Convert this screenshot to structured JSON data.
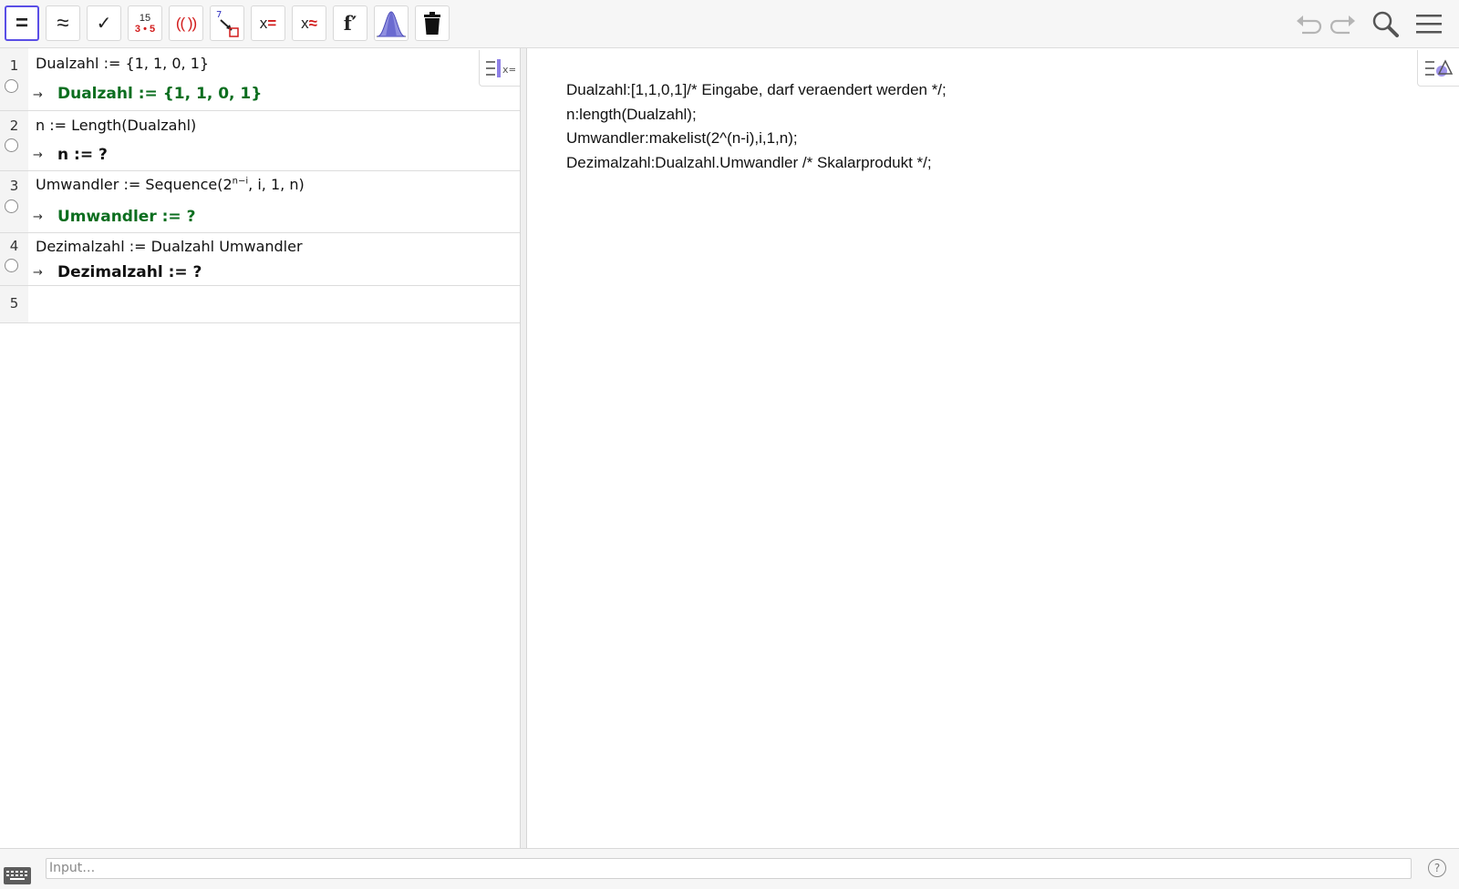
{
  "toolbar": {
    "tools": [
      {
        "name": "evaluate",
        "label": "="
      },
      {
        "name": "numeric",
        "label": "≈"
      },
      {
        "name": "keep-input",
        "label": "✓"
      },
      {
        "name": "factor",
        "label_top": "15",
        "label_bottom": "3 • 5"
      },
      {
        "name": "expand",
        "label": "(( ))"
      },
      {
        "name": "substitute",
        "label": "7"
      },
      {
        "name": "solve",
        "label": "x="
      },
      {
        "name": "solve-numerically",
        "label": "x≈"
      },
      {
        "name": "derivative",
        "label": "f′"
      },
      {
        "name": "probability",
        "label": ""
      },
      {
        "name": "delete",
        "label": ""
      }
    ],
    "selected_tool": "evaluate"
  },
  "cas": {
    "rows": [
      {
        "num": "1",
        "input": "Dualzahl := {1, 1, 0, 1}",
        "output": "Dualzahl  :=  {1, 1, 0, 1}",
        "output_color": "green"
      },
      {
        "num": "2",
        "input": "n := Length(Dualzahl)",
        "output": "n  :=  ?",
        "output_color": "black"
      },
      {
        "num": "3",
        "input_prefix": "Umwandler := Sequence(2",
        "input_sup": "n−i",
        "input_suffix": ", i, 1, n)",
        "output": "Umwandler  :=  ?",
        "output_color": "green"
      },
      {
        "num": "4",
        "input": "Dezimalzahl := Dualzahl Umwandler",
        "output": "Dezimalzahl  :=  ?",
        "output_color": "black"
      },
      {
        "num": "5",
        "input": "",
        "output": ""
      }
    ],
    "arrow": "→"
  },
  "text_view": {
    "lines": [
      "Dualzahl:[1,1,0,1]/* Eingabe, darf veraendert werden */;",
      "n:length(Dualzahl);",
      "Umwandler:makelist(2^(n-i),i,1,n);",
      "Dezimalzahl:Dualzahl.Umwandler /* Skalarprodukt */;"
    ]
  },
  "input_bar": {
    "placeholder": "Input…",
    "help": "?"
  },
  "colors": {
    "accent": "#5a4ee6",
    "output_green": "#0b6e1f",
    "toolbar_bg": "#f6f6f6"
  }
}
